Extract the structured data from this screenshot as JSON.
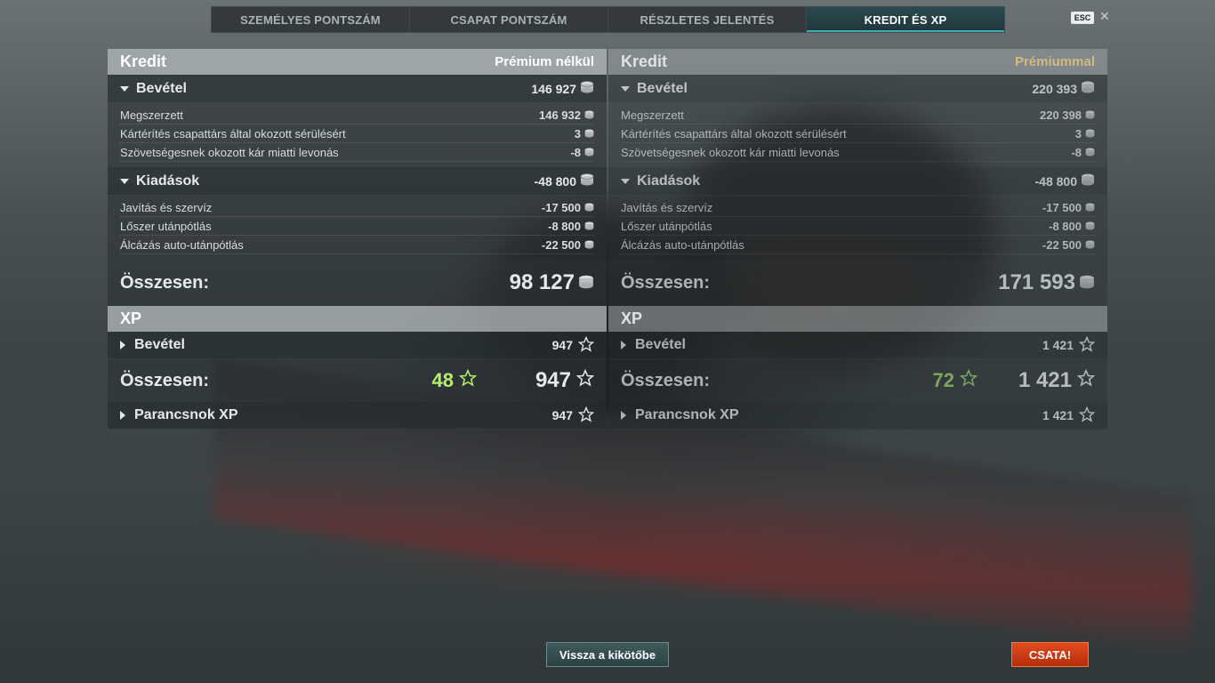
{
  "tabs": [
    {
      "label": "SZEMÉLYES PONTSZÁM"
    },
    {
      "label": "CSAPAT PONTSZÁM"
    },
    {
      "label": "RÉSZLETES JELENTÉS"
    },
    {
      "label": "KREDIT ÉS XP"
    }
  ],
  "active_tab": "KREDIT ÉS XP",
  "esc_label": "ESC",
  "close_glyph": "✕",
  "left": {
    "credit_title": "Kredit",
    "mode_label": "Prémium nélkül",
    "income": {
      "label": "Bevétel",
      "total": "146 927",
      "rows": [
        {
          "label": "Megszerzett",
          "value": "146 932"
        },
        {
          "label": "Kártérítés csapattárs által okozott sérülésért",
          "value": "3"
        },
        {
          "label": "Szövetségesnek okozott kár miatti levonás",
          "value": "-8"
        }
      ]
    },
    "expenses": {
      "label": "Kiadások",
      "total": "-48 800",
      "rows": [
        {
          "label": "Javítás és szervíz",
          "value": "-17 500"
        },
        {
          "label": "Lőszer utánpótlás",
          "value": "-8 800"
        },
        {
          "label": "Álcázás auto-utánpótlás",
          "value": "-22 500"
        }
      ]
    },
    "total_label": "Összesen:",
    "total_value": "98 127",
    "xp_title": "XP",
    "xp_income_label": "Bevétel",
    "xp_income_value": "947",
    "xp_total_label": "Összesen:",
    "xp_bonus": "48",
    "xp_total_value": "947",
    "commander_label": "Parancsnok XP",
    "commander_value": "947"
  },
  "right": {
    "credit_title": "Kredit",
    "mode_label": "Prémiummal",
    "income": {
      "label": "Bevétel",
      "total": "220 393",
      "rows": [
        {
          "label": "Megszerzett",
          "value": "220 398"
        },
        {
          "label": "Kártérítés csapattárs által okozott sérülésért",
          "value": "3"
        },
        {
          "label": "Szövetségesnek okozott kár miatti levonás",
          "value": "-8"
        }
      ]
    },
    "expenses": {
      "label": "Kiadások",
      "total": "-48 800",
      "rows": [
        {
          "label": "Javítás és szervíz",
          "value": "-17 500"
        },
        {
          "label": "Lőszer utánpótlás",
          "value": "-8 800"
        },
        {
          "label": "Álcázás auto-utánpótlás",
          "value": "-22 500"
        }
      ]
    },
    "total_label": "Összesen:",
    "total_value": "171 593",
    "xp_title": "XP",
    "xp_income_label": "Bevétel",
    "xp_income_value": "1 421",
    "xp_total_label": "Összesen:",
    "xp_bonus": "72",
    "xp_total_value": "1 421",
    "commander_label": "Parancsnok XP",
    "commander_value": "1 421"
  },
  "buttons": {
    "back_label": "Vissza a kikötőbe",
    "battle_label": "CSATA!"
  },
  "colors": {
    "premium_label": "#d3ba7d",
    "xp_bonus_free": "#b7ef6c",
    "battle_button": "#d23c14",
    "active_tab_accent": "#3fb0b0"
  },
  "icons": {
    "credit": "credit-coin-icon",
    "xp": "xp-star-icon"
  }
}
